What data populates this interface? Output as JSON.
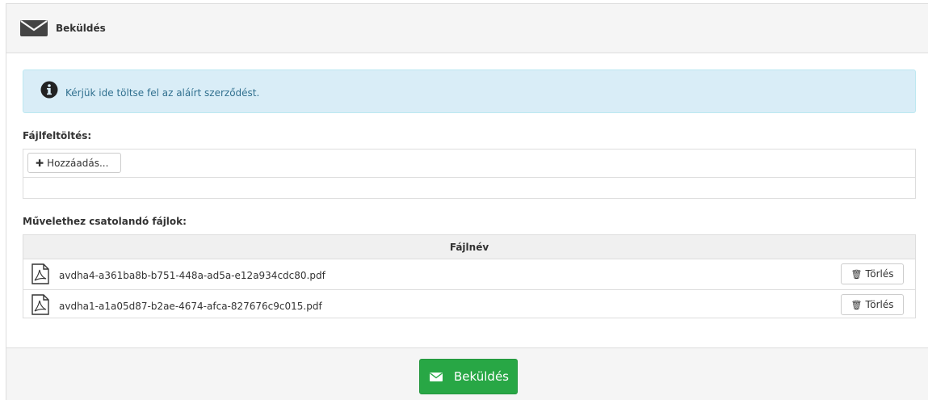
{
  "header": {
    "title": "Beküldés",
    "icon": "envelope-icon"
  },
  "alert": {
    "text": "Kérjük ide töltse fel az aláírt szerződést.",
    "icon": "info-circle-icon"
  },
  "upload": {
    "label": "Fájlfeltöltés:",
    "add_button": "Hozzáadás..."
  },
  "files": {
    "label": "Művelethez csatolandó fájlok:",
    "column_header": "Fájlnév",
    "rows": [
      {
        "name": "avdha4-a361ba8b-b751-448a-ad5a-e12a934cdc80.pdf",
        "delete_label": "Törlés"
      },
      {
        "name": "avdha1-a1a05d87-b2ae-4674-afca-827676c9c015.pdf",
        "delete_label": "Törlés"
      }
    ]
  },
  "footer": {
    "submit_label": "Beküldés"
  },
  "colors": {
    "success": "#28a745",
    "info_bg": "#d9edf7",
    "info_text": "#31708f"
  }
}
